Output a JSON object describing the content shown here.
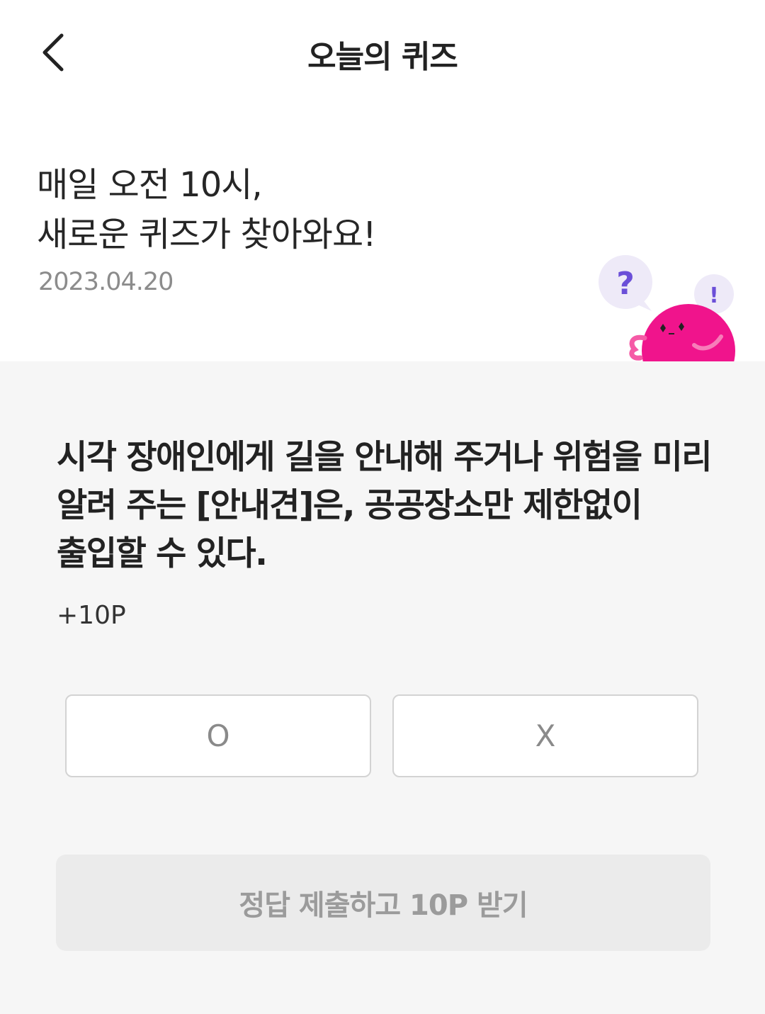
{
  "header": {
    "title": "오늘의 퀴즈",
    "back_icon": "chevron-left-icon"
  },
  "intro": {
    "line1": "매일 오전 10시,",
    "line2": "새로운 퀴즈가 찾아와요!",
    "date": "2023.04.20"
  },
  "mascot": {
    "question_mark": "?",
    "exclamation_mark": "!",
    "body_color": "#f0148c",
    "bubble_color": "#eeeaf8",
    "mark_color": "#6b4fd8"
  },
  "quiz": {
    "question": "시각 장애인에게 길을 안내해 주거나 위험을 미리 알려 주는 [안내견]은, 공공장소만 제한없이 출입할 수 있다.",
    "reward": "+10P",
    "options": [
      "O",
      "X"
    ]
  },
  "submit": {
    "label": "정답 제출하고 10P 받기"
  }
}
